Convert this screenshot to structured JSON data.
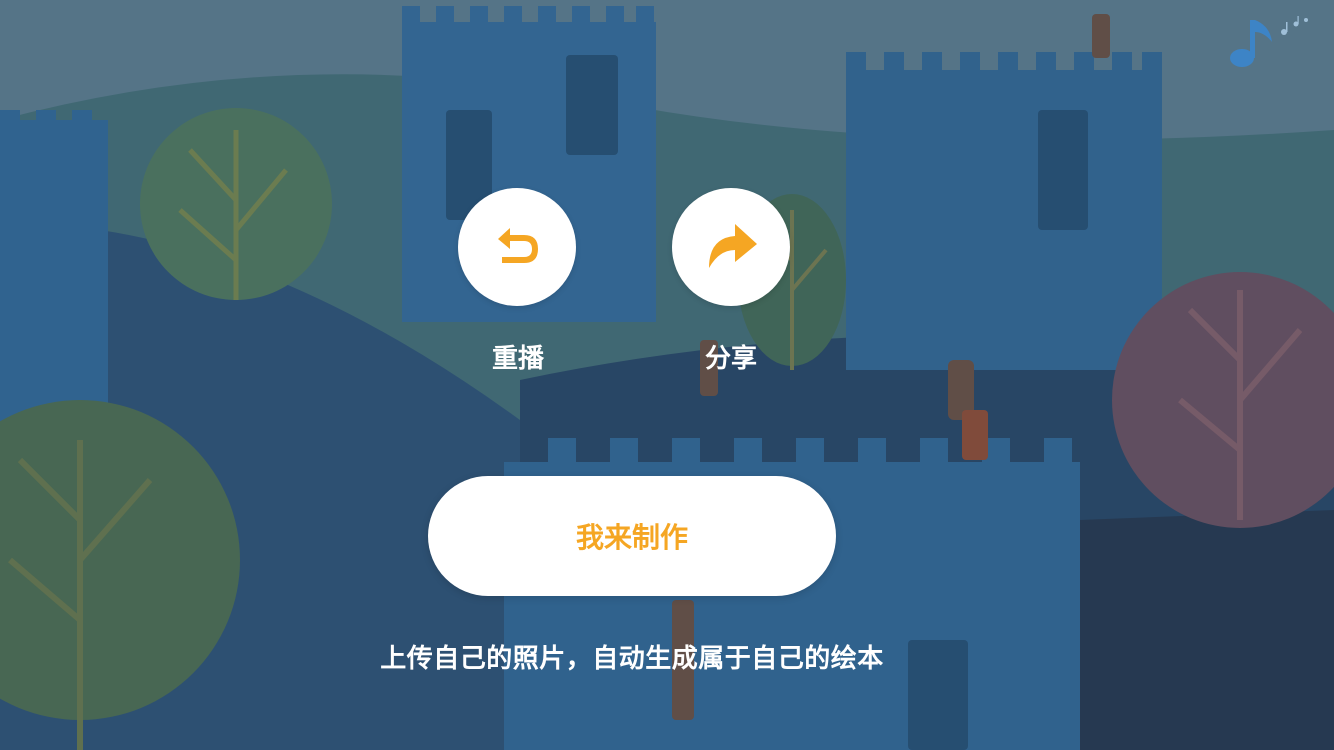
{
  "colors": {
    "accent": "#F5A623",
    "music_icon": "#3d84c6",
    "button_bg": "#FFFFFF"
  },
  "header": {
    "music_icon": "music-note-icon"
  },
  "actions": {
    "replay": {
      "icon": "replay-arrow-icon",
      "label": "重播"
    },
    "share": {
      "icon": "share-arrow-icon",
      "label": "分享"
    }
  },
  "primary": {
    "make_label": "我来制作"
  },
  "subtitle": "上传自己的照片，自动生成属于自己的绘本"
}
